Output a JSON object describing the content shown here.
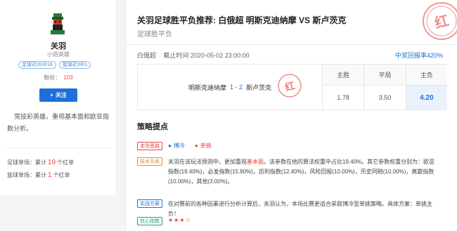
{
  "profile": {
    "name": "关羽",
    "subname": "小炮英雄",
    "badges": [
      "足球近20中16",
      "篮球近3中1"
    ],
    "fans_label": "粉丝：",
    "fans_count": "103",
    "follow_label": "关注",
    "bio": "竞技彩英雄，重视基本面和欧亚指数分析。",
    "stats": [
      {
        "label": "足球单场：累计",
        "count": "19",
        "suffix": "个红单"
      },
      {
        "label": "篮球单场：累计",
        "count": "1",
        "suffix": "个红单"
      }
    ]
  },
  "article": {
    "title": "关羽足球胜平负推荐: 白俄超 明斯克迪纳摩 VS 斯卢茨克",
    "subtitle": "足球胜平负",
    "league": "白俄超",
    "deadline": "截止时间 2020-05-02 23:00:00",
    "return_rate": "中奖回报率420%",
    "stamp_text": "红"
  },
  "match": {
    "home": "明斯克迪纳摩",
    "score": "1 - 2",
    "away": "斯卢茨克",
    "columns": [
      {
        "head": "主胜",
        "value": "1.78"
      },
      {
        "head": "平局",
        "value": "3.50"
      },
      {
        "head": "主负",
        "value": "4.20"
      }
    ]
  },
  "strategy": {
    "section_title": "策略提点",
    "tag_focus": "本场思路",
    "pick_a": "博冷",
    "pick_b": "单挑",
    "tag_style": "技术风格",
    "style_text_1": "关羽在该玩法预测中，更加重视",
    "style_text_hl": "基本面",
    "style_text_2": "。该参数在他的算法权重中占比19.40%。其它参数权重分别为：欧亚指数(19.40%)，必发指数(15.80%)，凯利指数(12.40%)，风险回报(10.00%)，历史同赔(10.00%)，离散指数(10.00%)，其他(3.00%)。",
    "tag_plan": "实战方案",
    "plan_text": "在对赛前的各种因素进行分析计算后，关羽认为，本场比赛更适合采取博冷型单挑策略。具体方案：单挑主负！",
    "tag_confidence": "信心指数",
    "confidence_stars": "★★★☆"
  },
  "colors": {
    "accent": "#1e6fd9",
    "red": "#e64340"
  }
}
